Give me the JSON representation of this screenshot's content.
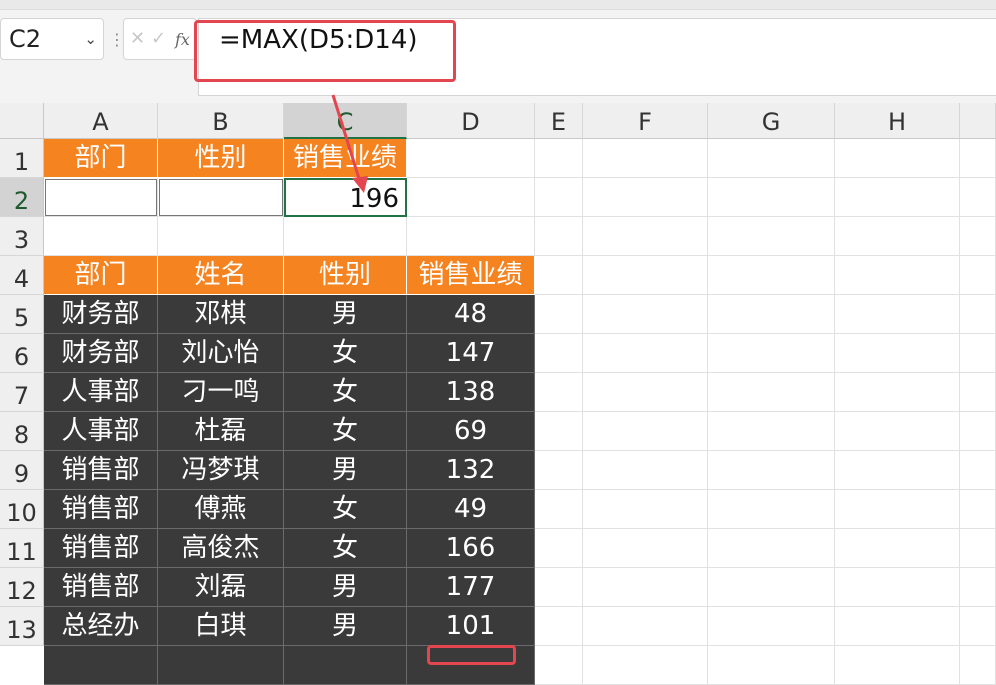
{
  "name_box": {
    "value": "C2"
  },
  "formula_bar": {
    "value": "=MAX(D5:D14)",
    "fx_label": "fx"
  },
  "columns": [
    "A",
    "B",
    "C",
    "D",
    "E",
    "F",
    "G",
    "H"
  ],
  "rows": [
    "1",
    "2",
    "3",
    "4",
    "5",
    "6",
    "7",
    "8",
    "9",
    "10",
    "11",
    "12",
    "13"
  ],
  "criteria_headers": [
    "部门",
    "性别",
    "销售业绩"
  ],
  "result_value": "196",
  "table": {
    "headers": [
      "部门",
      "姓名",
      "性别",
      "销售业绩"
    ],
    "rows": [
      [
        "财务部",
        "邓棋",
        "男",
        "48"
      ],
      [
        "财务部",
        "刘心怡",
        "女",
        "147"
      ],
      [
        "人事部",
        "刁一鸣",
        "女",
        "138"
      ],
      [
        "人事部",
        "杜磊",
        "女",
        "69"
      ],
      [
        "销售部",
        "冯梦琪",
        "男",
        "132"
      ],
      [
        "销售部",
        "傅燕",
        "女",
        "49"
      ],
      [
        "销售部",
        "高俊杰",
        "女",
        "166"
      ],
      [
        "销售部",
        "刘磊",
        "男",
        "177"
      ],
      [
        "总经办",
        "白琪",
        "男",
        "101"
      ]
    ]
  },
  "colors": {
    "header_orange": "#f58320",
    "data_dark": "#3a3a3a",
    "selection_green": "#217346",
    "highlight_red": "#e4464f"
  }
}
